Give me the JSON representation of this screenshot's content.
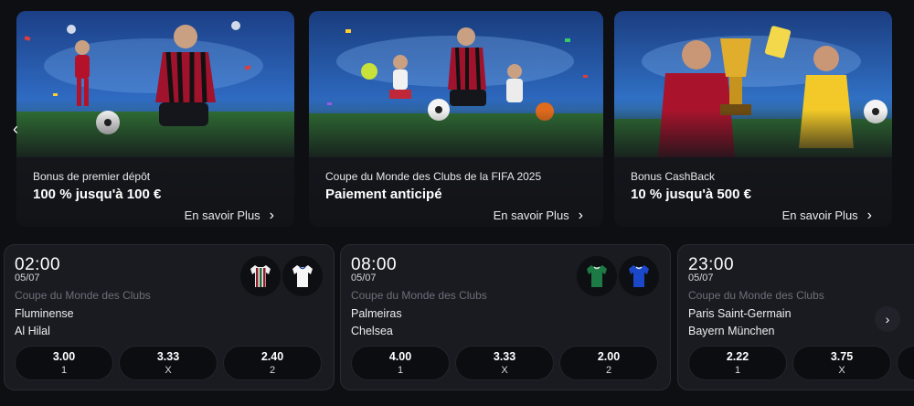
{
  "promos": [
    {
      "subtitle": "Bonus de premier dépôt",
      "headline": "100 % jusqu'à 100 €",
      "cta": "En savoir Plus"
    },
    {
      "subtitle": "Coupe du Monde des Clubs de la FIFA 2025",
      "headline": "Paiement anticipé",
      "cta": "En savoir Plus"
    },
    {
      "subtitle": "Bonus CashBack",
      "headline": "10 % jusqu'à 500 €",
      "cta": "En savoir Plus"
    }
  ],
  "matches": [
    {
      "time": "02:00",
      "date": "05/07",
      "competition": "Coupe du Monde des Clubs",
      "home": "Fluminense",
      "away": "Al Hilal",
      "home_kit": "striped-maroon-green-kit",
      "away_kit": "white-kit",
      "odds": [
        {
          "value": "3.00",
          "label": "1"
        },
        {
          "value": "3.33",
          "label": "X"
        },
        {
          "value": "2.40",
          "label": "2"
        }
      ]
    },
    {
      "time": "08:00",
      "date": "05/07",
      "competition": "Coupe du Monde des Clubs",
      "home": "Palmeiras",
      "away": "Chelsea",
      "home_kit": "green-kit",
      "away_kit": "blue-kit",
      "odds": [
        {
          "value": "4.00",
          "label": "1"
        },
        {
          "value": "3.33",
          "label": "X"
        },
        {
          "value": "2.00",
          "label": "2"
        }
      ]
    },
    {
      "time": "23:00",
      "date": "05/07",
      "competition": "Coupe du Monde des Clubs",
      "home": "Paris Saint-Germain",
      "away": "Bayern München",
      "odds": [
        {
          "value": "2.22",
          "label": "1"
        },
        {
          "value": "3.75",
          "label": "X"
        }
      ]
    }
  ],
  "colors": {
    "background": "#0e0f13",
    "card": "#1a1b21",
    "odd_button": "#0c0d11",
    "muted_text": "#6d6e78"
  }
}
